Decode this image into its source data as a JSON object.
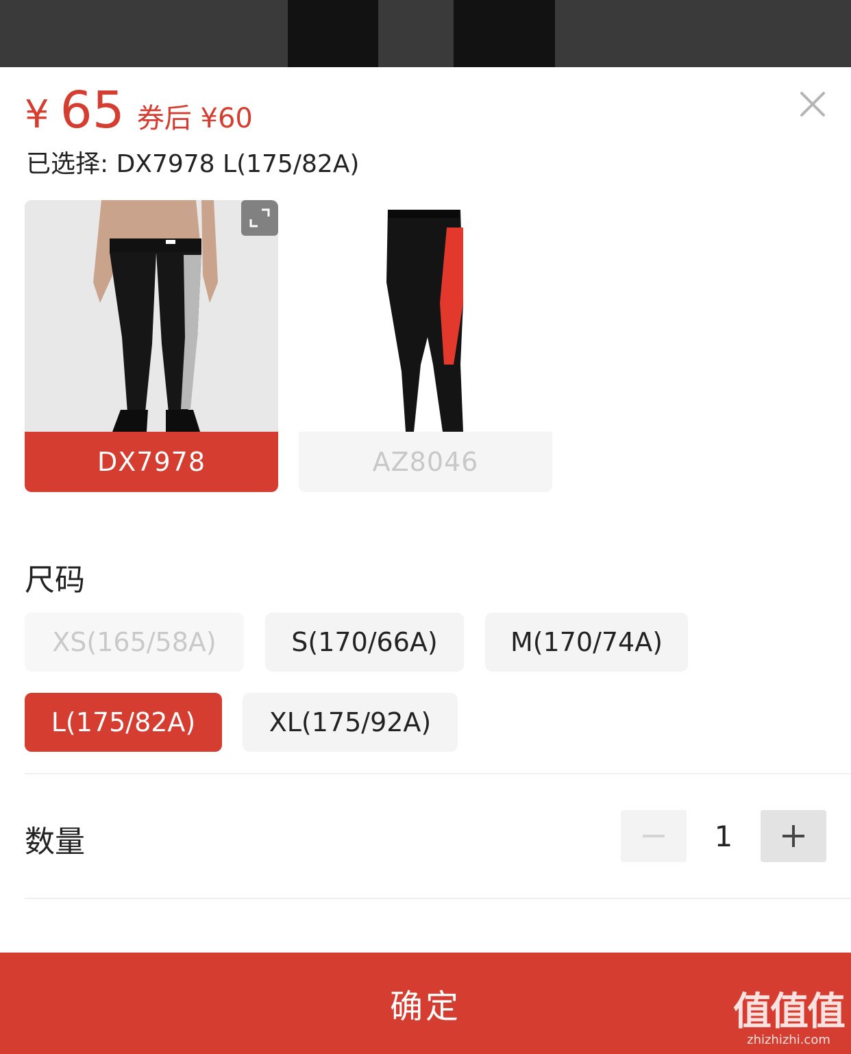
{
  "price": {
    "symbol": "¥",
    "value": "65",
    "coupon_text": "券后 ¥60"
  },
  "selected": {
    "text": "已选择: DX7978 L(175/82A)"
  },
  "variants": [
    {
      "code": "DX7978",
      "state": "selected"
    },
    {
      "code": "AZ8046",
      "state": "unavailable"
    }
  ],
  "size_section": {
    "title": "尺码",
    "options": [
      {
        "label": "XS(165/58A)",
        "state": "disabled"
      },
      {
        "label": "S(170/66A)",
        "state": "available"
      },
      {
        "label": "M(170/74A)",
        "state": "available"
      },
      {
        "label": "L(175/82A)",
        "state": "selected"
      },
      {
        "label": "XL(175/92A)",
        "state": "available"
      }
    ]
  },
  "quantity": {
    "label": "数量",
    "value": "1",
    "minus_icon": "minus-icon",
    "plus_icon": "plus-icon"
  },
  "confirm": {
    "label": "确定"
  },
  "watermark": {
    "mark": "值值值",
    "url": "zhizhizhi.com"
  },
  "colors": {
    "accent": "#d43d2f",
    "chip_bg": "#f4f4f4",
    "disabled_text": "#c9c9c9"
  },
  "icons": {
    "close": "close-icon",
    "expand": "expand-icon"
  }
}
